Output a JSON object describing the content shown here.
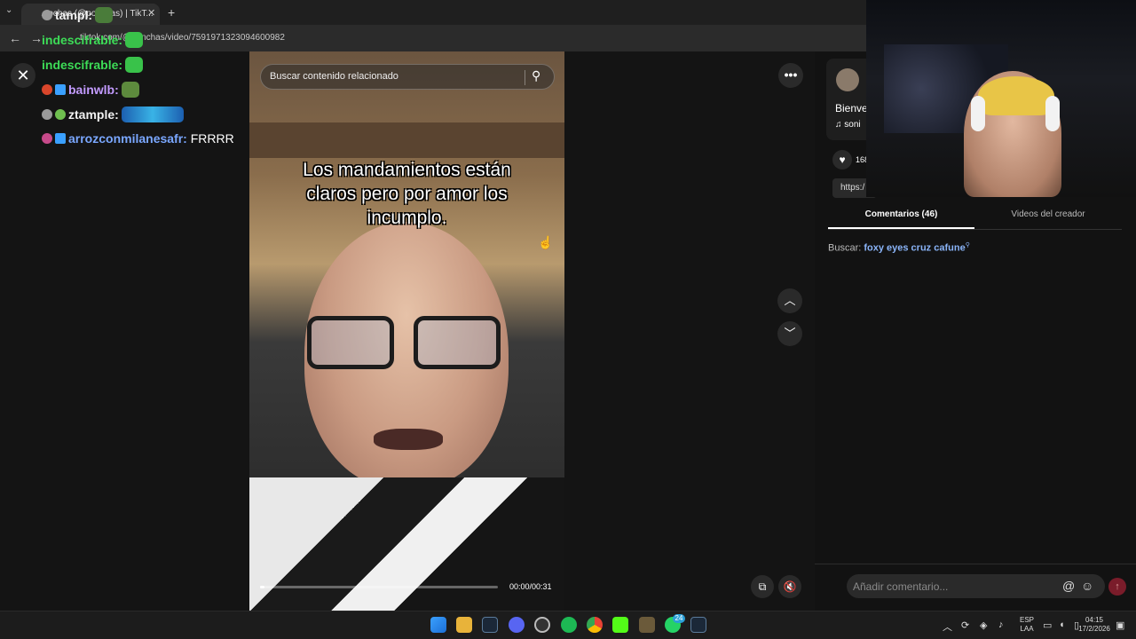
{
  "browser": {
    "tab_title": "...ochas (@ponchas) | TikT...",
    "url": "tiktok.com/@ponchas/video/7591971323094600982",
    "tab_close": "✕",
    "new_tab": "+",
    "back": "←",
    "forward": "→"
  },
  "chat": [
    {
      "user": "tampl",
      "message": "",
      "color": "#f2f2f2"
    },
    {
      "user": "indescifrable",
      "message": "",
      "color": "#3ddc57"
    },
    {
      "user": "indescifrable",
      "message": "",
      "color": "#3ddc57"
    },
    {
      "user": "bainwlb",
      "message": "",
      "color": "#c39bff"
    },
    {
      "user": "ztample",
      "message": "",
      "color": "#f2f2f2"
    },
    {
      "user": "arrozconmilanesafr",
      "message": "FRRRR",
      "color": "#7aa7ff"
    }
  ],
  "video": {
    "search_placeholder": "Buscar contenido relacionado",
    "caption": "Los mandamientos están claros pero por amor los incumplo.",
    "time": "00:00/00:31",
    "progress": 0.02
  },
  "controls": {
    "close": "✕",
    "more": "•••",
    "up": "︿",
    "down": "﹀"
  },
  "right_panel": {
    "author_name": "Bienve",
    "music": "♫ soni",
    "like_count": "168",
    "link": "https:/",
    "tab_comments": "Comentarios (46)",
    "tab_creator": "Videos del creador",
    "search_label": "Buscar:",
    "search_term": "foxy eyes cruz cafune",
    "comment_placeholder": "Añadir comentario..."
  },
  "taskbar": {
    "lang_top": "ESP",
    "lang_bottom": "LAA",
    "time": "04:15",
    "date": "17/2/2026",
    "whatsapp_badge": "24"
  }
}
